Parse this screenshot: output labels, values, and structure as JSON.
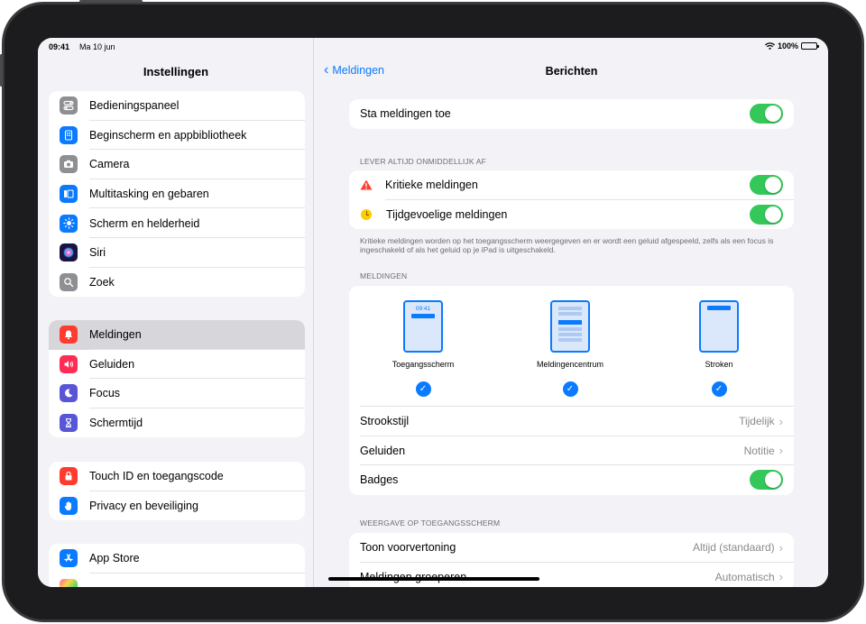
{
  "status": {
    "time": "09:41",
    "date": "Ma 10 jun",
    "battery": "100%"
  },
  "sidebar": {
    "title": "Instellingen",
    "group1": [
      {
        "label": "Bedieningspaneel",
        "icon": "control-center-icon",
        "color": "#8e8e93"
      },
      {
        "label": "Beginscherm en appbibliotheek",
        "icon": "home-screen-icon",
        "color": "#0a7aff"
      },
      {
        "label": "Camera",
        "icon": "camera-icon",
        "color": "#8e8e93"
      },
      {
        "label": "Multitasking en gebaren",
        "icon": "multitasking-icon",
        "color": "#0a7aff"
      },
      {
        "label": "Scherm en helderheid",
        "icon": "brightness-icon",
        "color": "#0a7aff"
      },
      {
        "label": "Siri",
        "icon": "siri-icon",
        "color": "#2a1b5c"
      },
      {
        "label": "Zoek",
        "icon": "search-icon",
        "color": "#8e8e93"
      }
    ],
    "group2": [
      {
        "label": "Meldingen",
        "icon": "notifications-icon",
        "color": "#ff3b30"
      },
      {
        "label": "Geluiden",
        "icon": "sounds-icon",
        "color": "#ff2d55"
      },
      {
        "label": "Focus",
        "icon": "focus-moon-icon",
        "color": "#5856d6"
      },
      {
        "label": "Schermtijd",
        "icon": "hourglass-icon",
        "color": "#5856d6"
      }
    ],
    "group3": [
      {
        "label": "Touch ID en toegangscode",
        "icon": "lock-icon",
        "color": "#ff3b30"
      },
      {
        "label": "Privacy en beveiliging",
        "icon": "hand-icon",
        "color": "#0a7aff"
      }
    ],
    "group4": [
      {
        "label": "App Store",
        "icon": "app-store-icon",
        "color": "#0a7aff"
      }
    ]
  },
  "detail": {
    "back_label": "Meldingen",
    "title": "Berichten",
    "allow_label": "Sta meldingen toe",
    "deliver_header": "LEVER ALTIJD ONMIDDELLIJK AF",
    "critical_label": "Kritieke meldingen",
    "time_sensitive_label": "Tijdgevoelige meldingen",
    "footnote": "Kritieke meldingen worden op het toegangsscherm weergegeven en er wordt een geluid afgespeeld, zelfs als een focus is ingeschakeld of als het geluid op je iPad is uitgeschakeld.",
    "notifications_header": "MELDINGEN",
    "styles": [
      {
        "label": "Toegangsscherm",
        "preview_time": "09:41"
      },
      {
        "label": "Meldingencentrum"
      },
      {
        "label": "Stroken"
      }
    ],
    "banner_style_label": "Strookstijl",
    "banner_style_value": "Tijdelijk",
    "sounds_label": "Geluiden",
    "sounds_value": "Notitie",
    "badges_label": "Badges",
    "lockscreen_header": "WEERGAVE OP TOEGANGSSCHERM",
    "preview_label": "Toon voorvertoning",
    "preview_value": "Altijd (standaard)",
    "group_label": "Meldingen groeperen",
    "group_value": "Automatisch"
  },
  "colors": {
    "accent": "#0a7aff",
    "toggle_on": "#34c759",
    "warning": "#ff3b30",
    "time_sensitive": "#ffcc00"
  }
}
